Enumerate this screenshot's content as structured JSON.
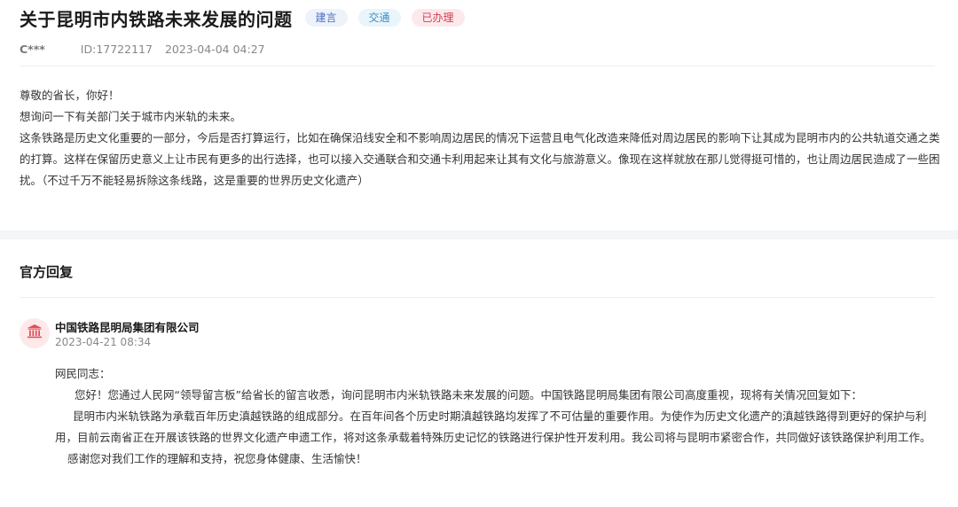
{
  "header": {
    "title": "关于昆明市内铁路未来发展的问题",
    "tags": [
      {
        "label": "建言",
        "color": "#4a6fc4"
      },
      {
        "label": "交通",
        "color": "#3b8fc7"
      },
      {
        "label": "已办理",
        "color": "#d33a4e"
      }
    ],
    "author": "C***",
    "id": "ID:17722117",
    "datetime": "2023-04-04 04:27"
  },
  "message": {
    "greeting": "尊敬的省长，你好！",
    "line1": "想询问一下有关部门关于城市内米轨的未来。",
    "paragraph": "这条铁路是历史文化重要的一部分，今后是否打算运行，比如在确保沿线安全和不影响周边居民的情况下运营且电气化改造来降低对周边居民的影响下让其成为昆明市内的公共轨道交通之类的打算。这样在保留历史意义上让市民有更多的出行选择，也可以接入交通联合和交通卡利用起来让其有文化与旅游意义。像现在这样就放在那儿觉得挺可惜的，也让周边居民造成了一些困扰。（不过千万不能轻易拆除这条线路，这是重要的世界历史文化遗产）"
  },
  "reply": {
    "section_title": "官方回复",
    "org_name": "中国铁路昆明局集团有限公司",
    "org_icon": "government-building-icon",
    "date": "2023-04-21 08:34",
    "salutation": "网民同志：",
    "p1": "您好！您通过人民网“领导留言板”给省长的留言收悉，询问昆明市内米轨铁路未来发展的问题。中国铁路昆明局集团有限公司高度重视，现将有关情况回复如下：",
    "p2": "昆明市内米轨铁路为承载百年历史滇越铁路的组成部分。在百年间各个历史时期滇越铁路均发挥了不可估量的重要作用。为使作为历史文化遗产的滇越铁路得到更好的保护与利用，目前云南省正在开展该铁路的世界文化遗产申遗工作，将对这条承载着特殊历史记忆的铁路进行保护性开发利用。我公司将与昆明市紧密合作，共同做好该铁路保护利用工作。",
    "p3": "感谢您对我们工作的理解和支持，祝您身体健康、生活愉快！"
  }
}
